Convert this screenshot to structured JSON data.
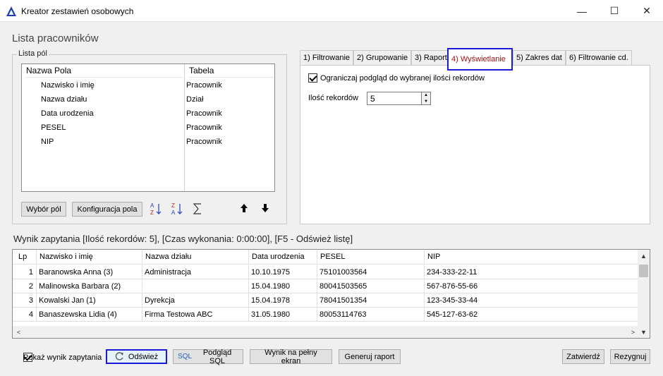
{
  "window": {
    "title": "Kreator zestawień osobowych",
    "minimize_glyph": "—",
    "maximize_glyph": "☐",
    "close_glyph": "✕"
  },
  "header": {
    "title": "Lista pracowników"
  },
  "fields_group": {
    "label": "Lista pól",
    "columns": [
      "Nazwa Pola",
      "Tabela"
    ],
    "rows": [
      {
        "name": "Nazwisko i imię",
        "table": "Pracownik"
      },
      {
        "name": "Nazwa działu",
        "table": "Dział"
      },
      {
        "name": "Data urodzenia",
        "table": "Pracownik"
      },
      {
        "name": "PESEL",
        "table": "Pracownik"
      },
      {
        "name": "NIP",
        "table": "Pracownik"
      }
    ],
    "buttons": {
      "select_fields": "Wybór pól",
      "field_config": "Konfiguracja pola"
    },
    "icons": {
      "sort_asc": "sort-az-icon",
      "sort_desc": "sort-za-icon",
      "sum": "sum-icon",
      "up": "arrow-up-icon",
      "down": "arrow-down-icon"
    }
  },
  "tabs": [
    {
      "label": "1) Filtrowanie"
    },
    {
      "label": "2) Grupowanie"
    },
    {
      "label": "3) Raport"
    },
    {
      "label": "4) Wyświetlanie",
      "active": true
    },
    {
      "label": "5) Zakres dat"
    },
    {
      "label": "6) Filtrowanie cd."
    }
  ],
  "display_tab": {
    "limit_checkbox_label": "Ograniczaj podgląd do wybranej ilości rekordów",
    "limit_checked": true,
    "count_label": "Ilość rekordów",
    "count_value": "5"
  },
  "result": {
    "label": "Wynik zapytania [Ilość rekordów: 5], [Czas wykonania:  0:00:00], [F5 - Odśwież listę]",
    "columns": [
      "Lp",
      "Nazwisko i imię",
      "Nazwa działu",
      "Data urodzenia",
      "PESEL",
      "NIP"
    ],
    "rows": [
      [
        "1",
        "Baranowska Anna (3)",
        "Administracja",
        "10.10.1975",
        "75101003564",
        "234-333-22-11"
      ],
      [
        "2",
        "Malinowska Barbara (2)",
        "",
        "15.04.1980",
        "80041503565",
        "567-876-55-66"
      ],
      [
        "3",
        "Kowalski Jan (1)",
        "Dyrekcja",
        "15.04.1978",
        "78041501354",
        "123-345-33-44"
      ],
      [
        "4",
        "Banaszewska Lidia (4)",
        "Firma Testowa ABC",
        "31.05.1980",
        "80053114763",
        "545-127-63-62"
      ]
    ]
  },
  "footer": {
    "show_result_label": "Pokaż wynik zapytania",
    "show_result_checked": true,
    "refresh": "Odśwież",
    "sql_icon_text": "SQL",
    "sql_preview": "Podgląd SQL",
    "fullscreen": "Wynik na pełny ekran",
    "generate_report": "Generuj raport",
    "confirm": "Zatwierdź",
    "cancel": "Rezygnuj"
  },
  "colors": {
    "active_tab_border": "#1a1ad8",
    "active_tab_text": "#a01010",
    "app_icon": "#1f3fb0"
  }
}
